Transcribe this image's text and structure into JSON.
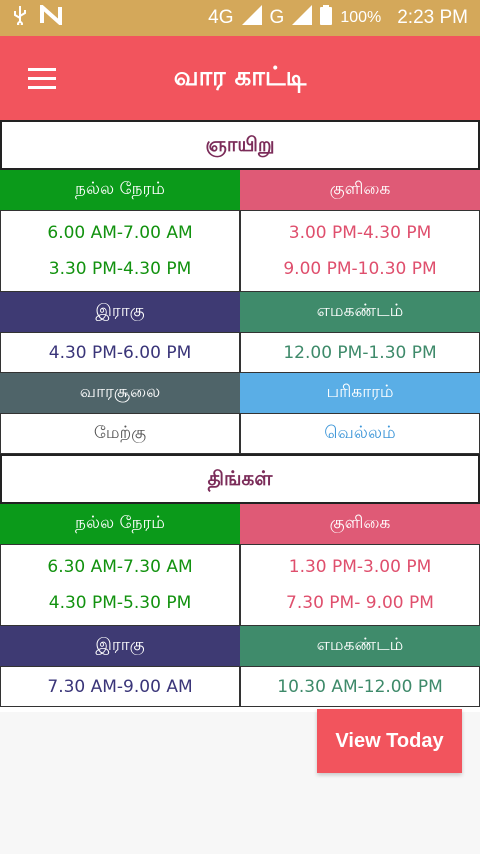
{
  "status_bar": {
    "network": "4G",
    "network_small": "4G",
    "carrier": "G",
    "battery": "100%",
    "time": "2:23 PM"
  },
  "app_bar": {
    "title": "வார காட்டி"
  },
  "days": [
    {
      "name": "ஞாயிறு",
      "nalla_neram_label": "நல்ல நேரம்",
      "nalla_neram": [
        "6.00 AM-7.00 AM",
        "3.30 PM-4.30 PM"
      ],
      "kuligai_label": "குளிகை",
      "kuligai": [
        "3.00 PM-4.30 PM",
        "9.00 PM-10.30 PM"
      ],
      "ragu_label": "இராகு",
      "ragu": "4.30 PM-6.00 PM",
      "emagandam_label": "எமகண்டம்",
      "emagandam": "12.00 PM-1.30 PM",
      "soolam_label": "வாரசூலை",
      "soolam": "மேற்கு",
      "parigaram_label": "பரிகாரம்",
      "parigaram": "வெல்லம்"
    },
    {
      "name": "திங்கள்",
      "nalla_neram_label": "நல்ல நேரம்",
      "nalla_neram": [
        "6.30 AM-7.30 AM",
        "4.30 PM-5.30 PM"
      ],
      "kuligai_label": "குளிகை",
      "kuligai": [
        "1.30 PM-3.00 PM",
        "7.30 PM- 9.00 PM"
      ],
      "ragu_label": "இராகு",
      "ragu": "7.30 AM-9.00 AM",
      "emagandam_label": "எமகண்டம்",
      "emagandam": "10.30 AM-12.00 PM"
    }
  ],
  "view_today_button": "View Today",
  "colors": {
    "status_bar": "#d4a85a",
    "app_bar": "#f2545d",
    "nalla_neram_header": "#0b9a1a",
    "kuligai_header": "#df5a76",
    "ragu_header": "#3e3a73",
    "emagandam_header": "#3f8b6b",
    "soolam_header": "#4f6469",
    "parigaram_header": "#5aaee6"
  }
}
